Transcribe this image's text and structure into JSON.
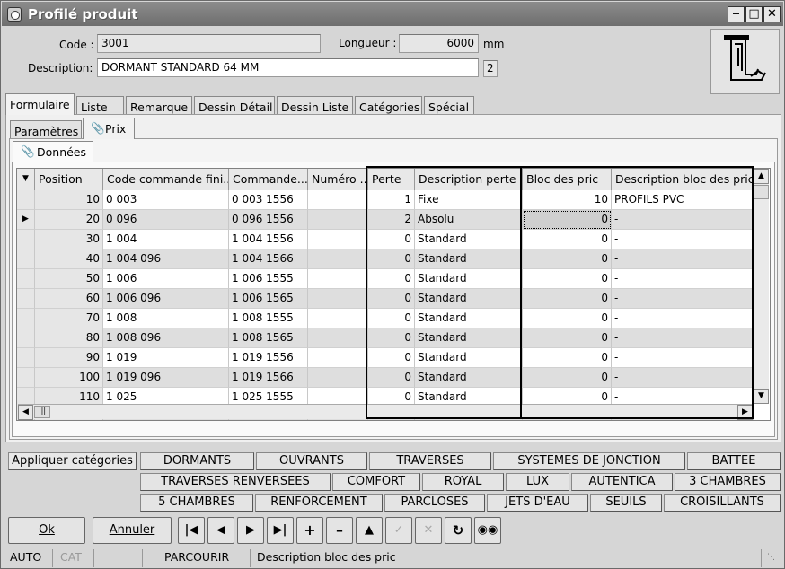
{
  "window": {
    "title": "Profilé produit"
  },
  "form": {
    "code_label": "Code :",
    "code_value": "3001",
    "longueur_label": "Longueur :",
    "longueur_value": "6000",
    "longueur_unit": "mm",
    "description_label": "Description:",
    "description_value": "DORMANT STANDARD 64 MM",
    "description_count": "2"
  },
  "main_tabs": [
    "Formulaire",
    "Liste",
    "Remarque",
    "Dessin Détail",
    "Dessin Liste",
    "Catégories",
    "Spécial"
  ],
  "sub_tabs": [
    "Paramètres",
    "Prix"
  ],
  "inner_tab": "Données",
  "grid": {
    "columns": [
      "Position",
      "Code commande fini...",
      "Commande...",
      "Numéro ...",
      "Perte",
      "Description perte",
      "Bloc des pric",
      "Description bloc des pric"
    ],
    "rows": [
      {
        "position": "10",
        "code": "0 003",
        "commande": "0 003 1556",
        "numero": "",
        "perte": "1",
        "desc_perte": "Fixe",
        "bloc": "10",
        "desc_bloc": "PROFILS PVC"
      },
      {
        "position": "20",
        "code": "0 096",
        "commande": "0 096 1556",
        "numero": "",
        "perte": "2",
        "desc_perte": "Absolu",
        "bloc": "0",
        "desc_bloc": "-"
      },
      {
        "position": "30",
        "code": "1 004",
        "commande": "1 004 1556",
        "numero": "",
        "perte": "0",
        "desc_perte": "Standard",
        "bloc": "0",
        "desc_bloc": "-"
      },
      {
        "position": "40",
        "code": "1 004 096",
        "commande": "1 004 1566",
        "numero": "",
        "perte": "0",
        "desc_perte": "Standard",
        "bloc": "0",
        "desc_bloc": "-"
      },
      {
        "position": "50",
        "code": "1 006",
        "commande": "1 006 1555",
        "numero": "",
        "perte": "0",
        "desc_perte": "Standard",
        "bloc": "0",
        "desc_bloc": "-"
      },
      {
        "position": "60",
        "code": "1 006 096",
        "commande": "1 006 1565",
        "numero": "",
        "perte": "0",
        "desc_perte": "Standard",
        "bloc": "0",
        "desc_bloc": "-"
      },
      {
        "position": "70",
        "code": "1 008",
        "commande": "1 008 1555",
        "numero": "",
        "perte": "0",
        "desc_perte": "Standard",
        "bloc": "0",
        "desc_bloc": "-"
      },
      {
        "position": "80",
        "code": "1 008 096",
        "commande": "1 008 1565",
        "numero": "",
        "perte": "0",
        "desc_perte": "Standard",
        "bloc": "0",
        "desc_bloc": "-"
      },
      {
        "position": "90",
        "code": "1 019",
        "commande": "1 019 1556",
        "numero": "",
        "perte": "0",
        "desc_perte": "Standard",
        "bloc": "0",
        "desc_bloc": "-"
      },
      {
        "position": "100",
        "code": "1 019 096",
        "commande": "1 019 1566",
        "numero": "",
        "perte": "0",
        "desc_perte": "Standard",
        "bloc": "0",
        "desc_bloc": "-"
      },
      {
        "position": "110",
        "code": "1 025",
        "commande": "1 025 1555",
        "numero": "",
        "perte": "0",
        "desc_perte": "Standard",
        "bloc": "0",
        "desc_bloc": "-"
      }
    ]
  },
  "categories": {
    "apply_label": "Appliquer catégories",
    "row1": [
      "DORMANTS",
      "OUVRANTS",
      "TRAVERSES",
      "SYSTEMES DE JONCTION",
      "BATTEE"
    ],
    "row2": [
      "TRAVERSES RENVERSEES",
      "COMFORT",
      "ROYAL",
      "LUX",
      "AUTENTICA",
      "3 CHAMBRES"
    ],
    "row3": [
      "5 CHAMBRES",
      "RENFORCEMENT",
      "PARCLOSES",
      "JETS D'EAU",
      "SEUILS",
      "CROISILLANTS"
    ]
  },
  "buttons": {
    "ok": "Ok",
    "annuler": "Annuler"
  },
  "status": {
    "mode1": "AUTO",
    "mode2": "CAT",
    "action": "PARCOURIR",
    "field": "Description bloc des pric"
  }
}
